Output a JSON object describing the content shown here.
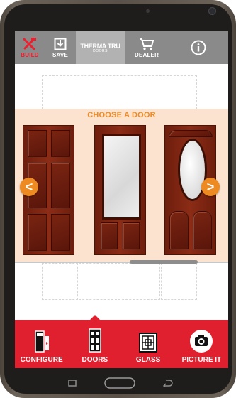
{
  "toolbar": {
    "build_label": "BUILD",
    "save_label": "SAVE",
    "brand_name": "THERMA TRU",
    "brand_sub": "DOORS",
    "dealer_label": "DEALER",
    "info_glyph": "i"
  },
  "chooser": {
    "title": "CHOOSE A DOOR",
    "prev_glyph": "<",
    "next_glyph": ">",
    "doors": [
      {
        "style": "six-panel"
      },
      {
        "style": "full-glass"
      },
      {
        "style": "oval-glass"
      }
    ]
  },
  "bottom_tabs": [
    {
      "label": "CONFIGURE",
      "icon": "configure-icon"
    },
    {
      "label": "DOORS",
      "icon": "doors-icon",
      "selected": true
    },
    {
      "label": "GLASS",
      "icon": "glass-icon"
    },
    {
      "label": "PICTURE IT",
      "icon": "camera-icon"
    }
  ],
  "colors": {
    "accent_red": "#e0202e",
    "accent_orange": "#f08a24",
    "chooser_bg": "#fbe3cf",
    "toolbar_bg": "#8a8a8a"
  }
}
